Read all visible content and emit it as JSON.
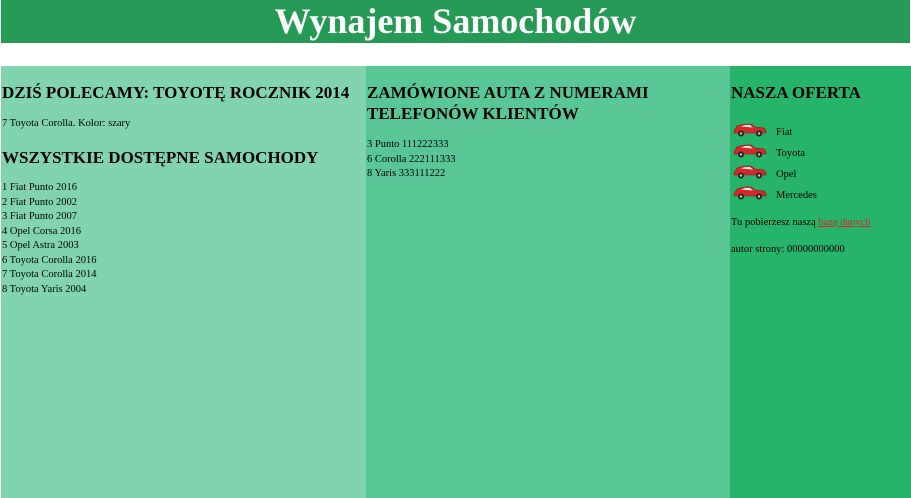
{
  "header": {
    "title": "Wynajem Samochodów"
  },
  "left": {
    "recommend_heading": "DZIŚ POLECAMY: TOYOTĘ ROCZNIK 2014",
    "recommend_text": "7 Toyota Corolla. Kolor: szary",
    "all_heading": "WSZYSTKIE DOSTĘPNE SAMOCHODY",
    "cars": [
      "1 Fiat Punto 2016",
      "2 Fiat Punto 2002",
      "3 Fiat Punto 2007",
      "4 Opel Corsa 2016",
      "5 Opel Astra 2003",
      "6 Toyota Corolla 2016",
      "7 Toyota Corolla 2014",
      "8 Toyota Yaris 2004"
    ]
  },
  "middle": {
    "heading": "ZAMÓWIONE AUTA Z NUMERAMI TELEFONÓW KLIENTÓW",
    "orders": [
      "3 Punto 111222333",
      "6 Corolla 222111333",
      "8 Yaris 333111222"
    ]
  },
  "right": {
    "heading": "NASZA OFERTA",
    "offers": [
      {
        "label": "Fiat",
        "icon": "red-car-icon"
      },
      {
        "label": "Toyota",
        "icon": "red-car-icon"
      },
      {
        "label": "Opel",
        "icon": "red-car-icon"
      },
      {
        "label": "Mercedes",
        "icon": "red-car-icon"
      }
    ],
    "download_text": "Tu pobierzesz naszą",
    "download_link": "bazę danych",
    "author": "autor strony: 00000000000"
  },
  "colors": {
    "banner": "#249a55",
    "left_column": "#82d4ae",
    "middle_column": "#58c795",
    "right_column": "#26b468",
    "link": "#d8262a",
    "car_body": "#d42a2a"
  }
}
